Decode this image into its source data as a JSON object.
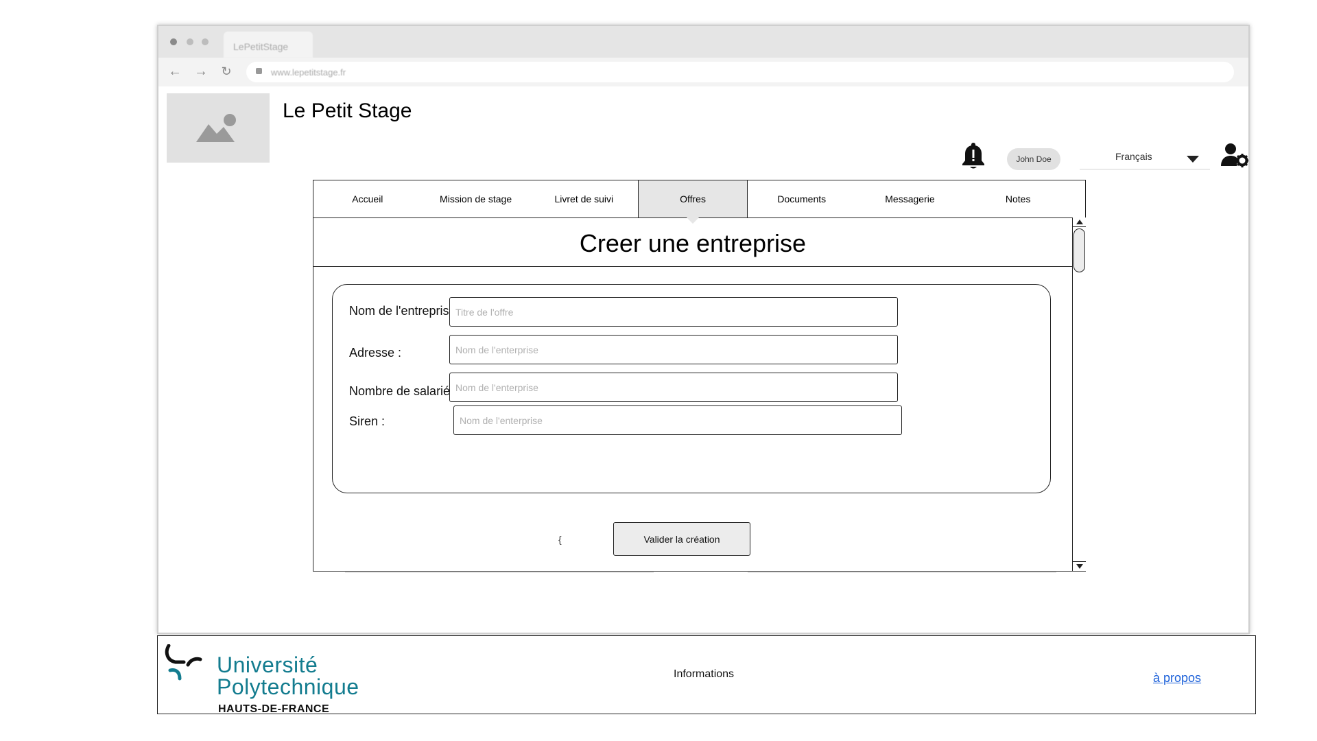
{
  "browser": {
    "tab_title": "LePetitStage",
    "url": "www.lepetitstage.fr"
  },
  "header": {
    "site_title": "Le Petit Stage",
    "user_name": "John Doe",
    "language": "Français"
  },
  "tabs": [
    {
      "label": "Accueil",
      "active": false
    },
    {
      "label": "Mission de stage",
      "active": false
    },
    {
      "label": "Livret de suivi",
      "active": false
    },
    {
      "label": "Offres",
      "active": true
    },
    {
      "label": "Documents",
      "active": false
    },
    {
      "label": "Messagerie",
      "active": false
    },
    {
      "label": "Notes",
      "active": false
    }
  ],
  "form": {
    "title": "Creer une entreprise",
    "fields": [
      {
        "label": "Nom de l'entreprise :",
        "value": "",
        "placeholder": "Titre de l'offre"
      },
      {
        "label": "Adresse :",
        "value": "",
        "placeholder": "Nom de l'enterprise"
      },
      {
        "label": "Nombre de salariés :",
        "value": "",
        "placeholder": "Nom de l'enterprise"
      },
      {
        "label": "Siren :",
        "value": "",
        "placeholder": "Nom de l'enterprise"
      }
    ],
    "stray_text": "{",
    "submit_label": "Valider la création"
  },
  "footer": {
    "logo_line1": "Université",
    "logo_line2": "Polytechnique",
    "logo_line3": "HAUTS-DE-FRANCE",
    "info": "Informations",
    "about_link": "à propos"
  },
  "colors": {
    "accent_teal": "#137c8f",
    "link_blue": "#1a5fd9",
    "active_tab": "#e6e6e6"
  }
}
